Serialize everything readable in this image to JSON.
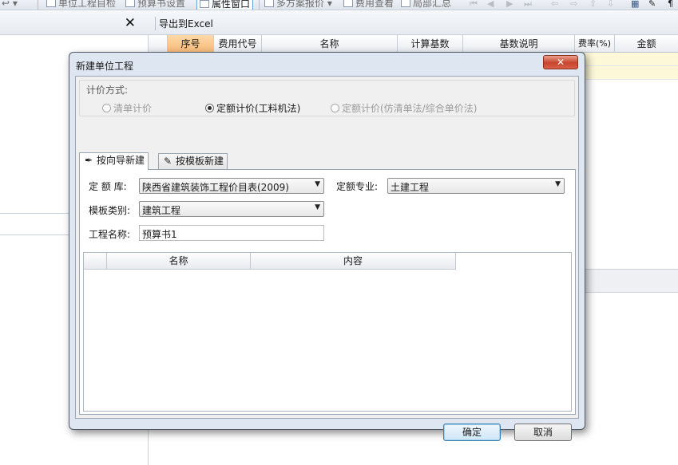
{
  "toolbar": {
    "partial_left": "↩ ▾",
    "unit_catalog": "单位工程目检",
    "budget_settings": "预算书设置",
    "property_window": "属性窗口",
    "multi_plan": "多方案报价",
    "cost_view": "费用查看",
    "local_summary": "局部汇总"
  },
  "left_panel": {
    "close": "✕"
  },
  "grid": {
    "export_excel": "导出到Excel",
    "columns": [
      "序号",
      "费用代号",
      "名称",
      "计算基数",
      "基数说明",
      "费率(%)",
      "金额"
    ],
    "selected_column": "序号"
  },
  "dialog": {
    "title": "新建单位工程",
    "close_label": "✕",
    "pricing_group_label": "计价方式:",
    "pricing_options": [
      {
        "label": "清单计价",
        "selected": false,
        "enabled": false
      },
      {
        "label": "定额计价(工料机法)",
        "selected": true,
        "enabled": true
      },
      {
        "label": "定额计价(仿清单法/综合单价法)",
        "selected": false,
        "enabled": false
      }
    ],
    "tabs": [
      {
        "label": "按向导新建",
        "icon": "wizard-icon",
        "active": true
      },
      {
        "label": "按模板新建",
        "icon": "template-icon",
        "active": false
      }
    ],
    "form": {
      "quota_label": "定 额 库:",
      "quota_value": "陕西省建筑装饰工程价目表(2009)",
      "specialty_label": "定额专业:",
      "specialty_value": "土建工程",
      "template_type_label": "模板类别:",
      "template_type_value": "建筑工程",
      "project_name_label": "工程名称:",
      "project_name_value": "预算书1"
    },
    "inner_grid_columns": [
      "",
      "名称",
      "内容"
    ],
    "ok_button": "确定",
    "cancel_button": "取消"
  }
}
